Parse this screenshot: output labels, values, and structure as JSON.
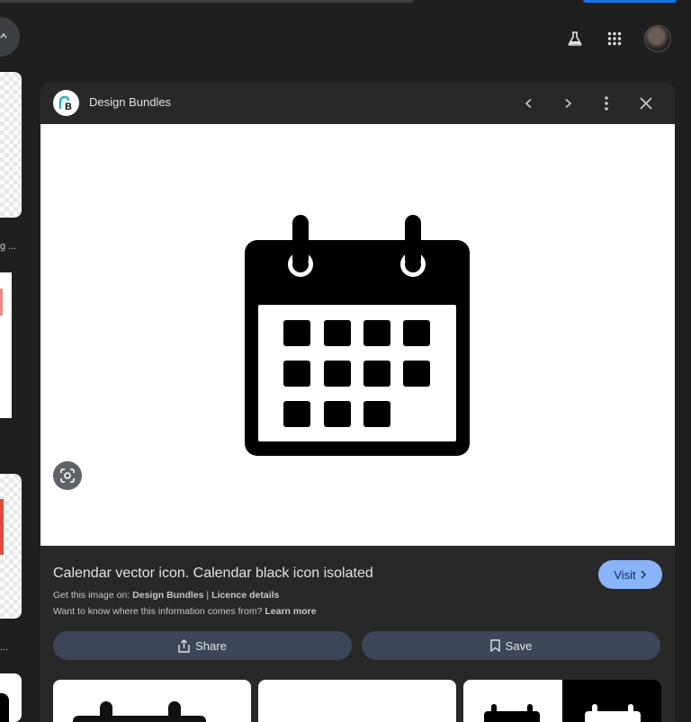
{
  "header": {
    "icons": [
      "back-icon",
      "labs-flask-icon",
      "apps-grid-icon",
      "account-avatar"
    ]
  },
  "left_strip": {
    "labels": [
      "g ...",
      "..."
    ]
  },
  "panel": {
    "source_name": "Design Bundles",
    "source_logo_letter": "B",
    "controls": [
      "chevron-left-icon",
      "chevron-right-icon",
      "more-vert-icon",
      "close-icon"
    ],
    "image_subject": "calendar-icon",
    "title": "Calendar vector icon. Calendar black icon isolated",
    "visit_label": "Visit",
    "meta_prefix": "Get this image on:",
    "meta_source": "Design Bundles",
    "meta_sep": "|",
    "meta_licence": "Licence details",
    "meta_question": "Want to know where this information comes from?",
    "meta_learn_more": "Learn more",
    "share_label": "Share",
    "save_label": "Save"
  },
  "colors": {
    "background": "#1f1f1f",
    "panel": "#282828",
    "visit_button": "#8ab4f8",
    "action_button": "#3c4658"
  }
}
